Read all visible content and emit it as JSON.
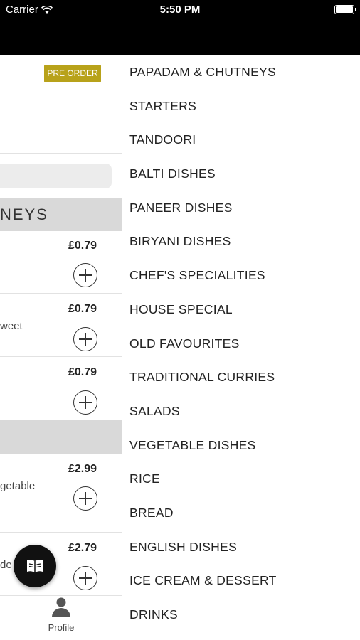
{
  "status_bar": {
    "carrier": "Carrier",
    "time": "5:50 PM"
  },
  "left_panel": {
    "preorder_label": "PRE ORDER",
    "category_header": "NEYS",
    "items": [
      {
        "price": "£0.79",
        "desc": ""
      },
      {
        "price": "£0.79",
        "desc": "weet"
      },
      {
        "price": "£0.79",
        "desc": ""
      },
      {
        "price": "£2.99",
        "desc": "getable"
      },
      {
        "price": "£2.79",
        "desc": "de"
      }
    ],
    "profile_label": "Profile",
    "icons": {
      "fab": "menu-book-icon",
      "profile": "person-icon"
    }
  },
  "drawer": {
    "categories": [
      "PAPADAM & CHUTNEYS",
      "STARTERS",
      "TANDOORI",
      "BALTI DISHES",
      "PANEER DISHES",
      "BIRYANI DISHES",
      "CHEF'S SPECIALITIES",
      "HOUSE SPECIAL",
      "OLD FAVOURITES",
      "TRADITIONAL CURRIES",
      "SALADS",
      "VEGETABLE DISHES",
      "RICE",
      "BREAD",
      "ENGLISH DISHES",
      "ICE CREAM & DESSERT",
      "DRINKS"
    ]
  },
  "colors": {
    "preorder_badge": "#b8a21a",
    "status_bar_bg": "#000000",
    "header_bg": "#d9d9d9"
  }
}
